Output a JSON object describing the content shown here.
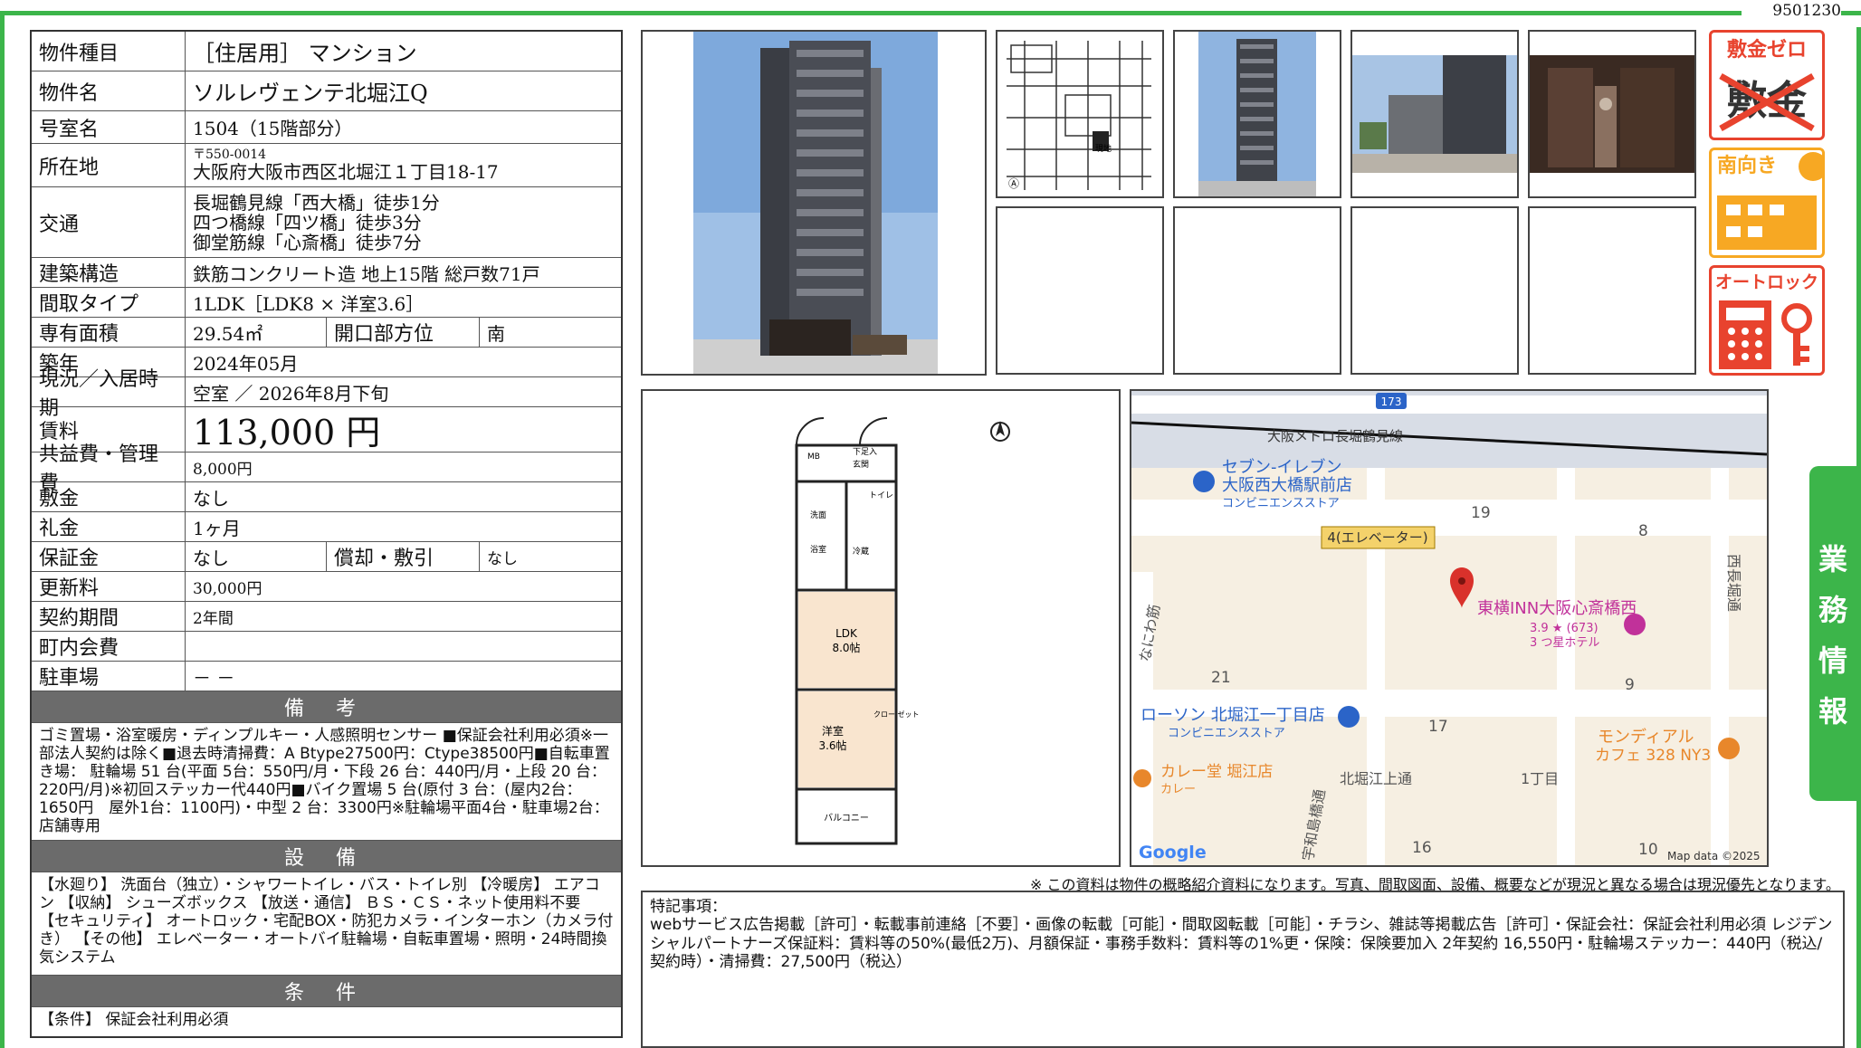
{
  "doc_id": "9501230",
  "info": {
    "type": {
      "label": "物件種目",
      "value": "［住居用］ マンション"
    },
    "name": {
      "label": "物件名",
      "value": "ソルレヴェンテ北堀江Q"
    },
    "room": {
      "label": "号室名",
      "value": "1504（15階部分）"
    },
    "address": {
      "label": "所在地",
      "postal": "〒550-0014",
      "value": "大阪府大阪市西区北堀江１丁目18-17"
    },
    "access": {
      "label": "交通",
      "lines": [
        "長堀鶴見線「西大橋」徒歩1分",
        "四つ橋線「四ツ橋」徒歩3分",
        "御堂筋線「心斎橋」徒歩7分"
      ]
    },
    "structure": {
      "label": "建築構造",
      "value": "鉄筋コンクリート造 地上15階 総戸数71戸"
    },
    "layout": {
      "label": "間取タイプ",
      "value": "1LDK［LDK8 × 洋室3.6］"
    },
    "area": {
      "label": "専有面積",
      "value": "29.54㎡",
      "sub_label": "開口部方位",
      "sub_value": "南"
    },
    "built": {
      "label": "築年",
      "value": "2024年05月"
    },
    "status": {
      "label": "現況／入居時期",
      "value": "空室 ／ 2026年8月下旬"
    },
    "rent": {
      "label": "賃料",
      "value": "113,000 円"
    },
    "fee": {
      "label": "共益費・管理費",
      "value": "8,000円"
    },
    "deposit": {
      "label": "敷金",
      "value": "なし"
    },
    "key_money": {
      "label": "礼金",
      "value": "1ヶ月"
    },
    "guarantee": {
      "label": "保証金",
      "value": "なし",
      "sub_label": "償却・敷引",
      "sub_value": "なし"
    },
    "renewal": {
      "label": "更新料",
      "value": "30,000円"
    },
    "contract": {
      "label": "契約期間",
      "value": "2年間"
    },
    "town_fee": {
      "label": "町内会費",
      "value": ""
    },
    "parking": {
      "label": "駐車場",
      "value": "－ －"
    }
  },
  "remarks": {
    "title": "備 考",
    "text": "ゴミ置場・浴室暖房・ディンプルキー・人感照明センサー ■保証会社利用必須※一部法人契約は除く■退去時清掃費：A Btype27500円：Ctype38500円■自転車置き場： 駐輪場 51 台(平面 5台：550円/月・下段 26 台：440円/月・上段 20 台：220円/月)※初回ステッカー代440円■バイク置場 5 台(原付 3 台：(屋内2台：1650円　屋外1台：1100円)・中型 2 台：3300円※駐輪場平面4台・駐車場2台：店舗専用"
  },
  "facilities": {
    "title": "設 備",
    "text": "【水廻り】 洗面台（独立）・シャワートイレ・バス・トイレ別 【冷暖房】 エアコン 【収納】 シューズボックス 【放送・通信】 ＢＳ・ＣＳ・ネット使用料不要 【セキュリティ】 オートロック・宅配BOX・防犯カメラ・インターホン（カメラ付き） 【その他】 エレベーター・オートバイ駐輪場・自転車置場・照明・24時間換気システム"
  },
  "conditions": {
    "title": "条 件",
    "text": "【条件】 保証会社利用必須"
  },
  "badges": {
    "zero_deposit": "敷金ゼロ",
    "zero_deposit_sub": "敷金",
    "south": "南向き",
    "autolock": "オートロック"
  },
  "map": {
    "labels": {
      "metro": "大阪メトロ長堀鶴見線",
      "seven_name": "セブン-イレブン",
      "seven_sub": "大阪西大橋駅前店",
      "seven_type": "コンビニエンスストア",
      "exit": "4(エレベーター)",
      "hotel": "東横INN大阪心斎橋西",
      "hotel_rating": "3.9 ★ (673)",
      "hotel_type": "3 つ星ホテル",
      "lawson": "ローソン 北堀江一丁目店",
      "lawson_type": "コンビニエンスストア",
      "curry": "カレー堂 堀江店",
      "curry_type": "カレー",
      "mondial": "モンディアル",
      "mondial_sub": "カフェ 328 NY3",
      "street1": "北堀江上通",
      "street2": "なにわ筋",
      "street3": "西長堀通",
      "street4": "宇和島橋通",
      "chome": "1丁目",
      "route": "173",
      "b19": "19",
      "b8": "8",
      "b21": "21",
      "b17": "17",
      "b9": "9",
      "b16": "16",
      "b10": "10",
      "google": "Google",
      "credit": "Map data ©2025"
    }
  },
  "plan": {
    "ldk": "LDK",
    "ldk_size": "8.0帖",
    "western": "洋室",
    "western_size": "3.6帖",
    "balcony": "バルコニー",
    "toilet": "トイレ",
    "bath": "浴室",
    "wash": "洗面",
    "entrance": "玄関",
    "shoes": "下足入",
    "kitchen": "冷蔵",
    "closet": "クロー ゼット",
    "mb": "MB",
    "north": "N"
  },
  "disclaimer": "※ この資料は物件の概略紹介資料になります。写真、間取図面、設備、概要などが現況と異なる場合は現況優先となります。",
  "notes": {
    "title": "特記事項：",
    "text": "webサービス広告掲載［許可］・転載事前連絡［不要］・画像の転載［可能］・間取図転載［可能］・チラシ、雑誌等掲載広告［許可］・保証会社：保証会社利用必須 レジデンシャルパートナーズ保証料：賃料等の50%(最低2万)、月額保証・事務手数料：賃料等の1%更・保険：保険要加入 2年契約 16,550円・駐輪場ステッカー：440円（税込/契約時）・清掃費：27,500円（税込）"
  },
  "side_tab": [
    "業",
    "務",
    "情",
    "報"
  ],
  "colors": {
    "green": "#3cb54a",
    "section": "#6b6b6b",
    "badge_red": "#e8432e",
    "badge_orange": "#f7a823"
  }
}
